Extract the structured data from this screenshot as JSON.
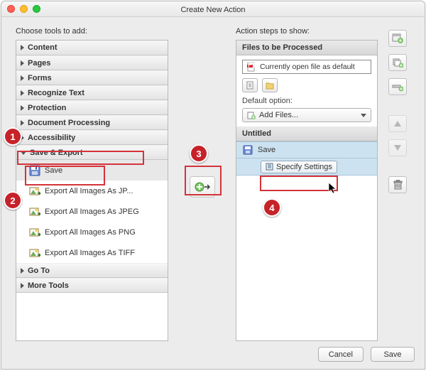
{
  "title": "Create New Action",
  "left": {
    "heading": "Choose tools to add:",
    "cats": {
      "content": "Content",
      "pages": "Pages",
      "forms": "Forms",
      "recognize": "Recognize Text",
      "protection": "Protection",
      "docproc": "Document Processing",
      "accessibility": "Accessibility",
      "saveexport": "Save & Export",
      "goto": "Go To",
      "moretools": "More Tools"
    },
    "items": {
      "save": "Save",
      "exp_jp": "Export All Images As JP...",
      "exp_jpeg": "Export All Images As JPEG",
      "exp_png": "Export All Images As PNG",
      "exp_tiff": "Export All Images As TIFF"
    }
  },
  "right": {
    "heading": "Action steps to show:",
    "files_header": "Files to be Processed",
    "current_file": "Currently open file as default",
    "default_label": "Default option:",
    "add_files": "Add Files...",
    "untitled": "Untitled",
    "step_save": "Save",
    "specify": "Specify Settings"
  },
  "footer": {
    "cancel": "Cancel",
    "save": "Save"
  }
}
